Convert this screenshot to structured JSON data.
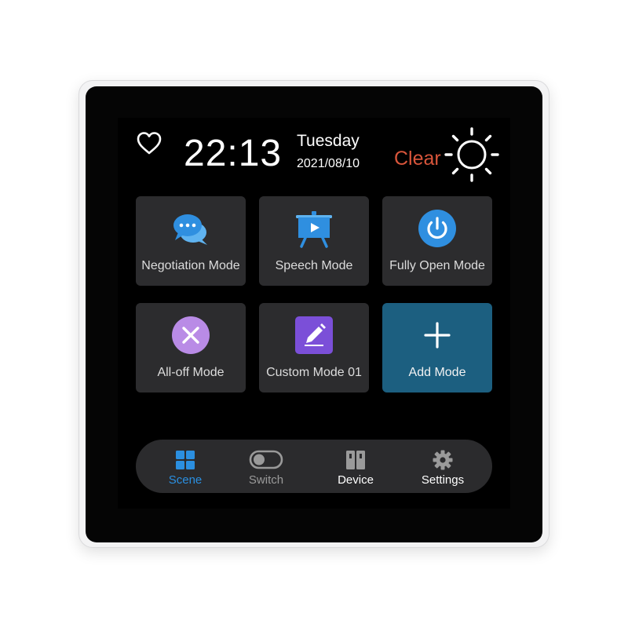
{
  "status_bar": {
    "time": "22:13",
    "day": "Tuesday",
    "date": "2021/08/10",
    "weather": "Clear",
    "weather_icon": "sun-icon",
    "favorite_icon": "heart-icon"
  },
  "modes": [
    {
      "label": "Negotiation Mode",
      "icon": "chat-bubbles-icon",
      "color": "#2f8fe0"
    },
    {
      "label": "Speech Mode",
      "icon": "presentation-board-icon",
      "color": "#2f8fe0"
    },
    {
      "label": "Fully Open Mode",
      "icon": "power-icon",
      "color": "#2f8fe0"
    },
    {
      "label": "All-off Mode",
      "icon": "close-circle-icon",
      "color": "#b98be6"
    },
    {
      "label": "Custom Mode 01",
      "icon": "pencil-icon",
      "color": "#7b4fd8"
    },
    {
      "label": "Add Mode",
      "icon": "plus-icon",
      "color": "#1c5f80"
    }
  ],
  "nav": {
    "items": [
      {
        "label": "Scene",
        "icon": "grid-icon",
        "active": true
      },
      {
        "label": "Switch",
        "icon": "toggle-icon",
        "active": false
      },
      {
        "label": "Device",
        "icon": "device-panel-icon",
        "active": false
      },
      {
        "label": "Settings",
        "icon": "gear-icon",
        "active": false
      }
    ],
    "active_color": "#2b8fe0"
  },
  "colors": {
    "accent": "#2b8fe0",
    "weather_text": "#d8553b",
    "tile_bg": "#2c2c2e",
    "add_tile_bg": "#1c5f80"
  }
}
